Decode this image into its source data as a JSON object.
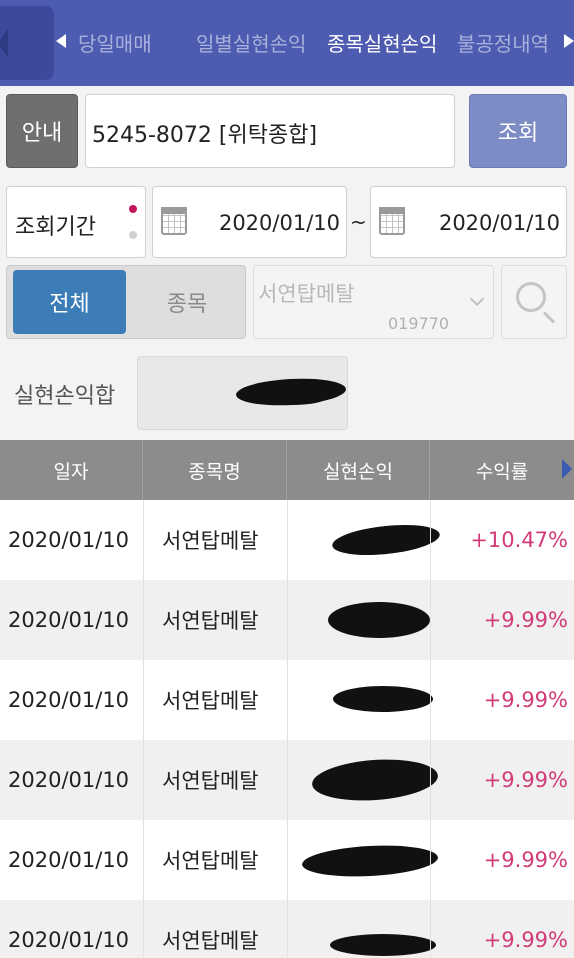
{
  "tabs": {
    "items": [
      "당일매매",
      "일별실현손익",
      "종목실현손익",
      "불공정내역"
    ],
    "active_index": 2
  },
  "account": {
    "guide_label": "안내",
    "selected": "5245-8072 [위탁종합]",
    "query_label": "조회"
  },
  "period": {
    "label": "조회기간",
    "start": "2020/01/10",
    "separator": "~",
    "end": "2020/01/10",
    "dot_colors": [
      "#c2185b",
      "#d0d0d0"
    ]
  },
  "filter": {
    "all_label": "전체",
    "item_label": "종목",
    "stock_name": "서연탑메탈",
    "stock_code": "019770"
  },
  "summary": {
    "label": "실현손익합"
  },
  "table": {
    "headers": [
      "일자",
      "종목명",
      "실현손익",
      "수익률"
    ],
    "rows": [
      {
        "date": "2020/01/10",
        "name": "서연탑메탈",
        "rate": "+10.47%"
      },
      {
        "date": "2020/01/10",
        "name": "서연탑메탈",
        "rate": "+9.99%"
      },
      {
        "date": "2020/01/10",
        "name": "서연탑메탈",
        "rate": "+9.99%"
      },
      {
        "date": "2020/01/10",
        "name": "서연탑메탈",
        "rate": "+9.99%"
      },
      {
        "date": "2020/01/10",
        "name": "서연탑메탈",
        "rate": "+9.99%"
      },
      {
        "date": "2020/01/10",
        "name": "서연탑메탈",
        "rate": "+9.99%"
      }
    ]
  },
  "colors": {
    "header_bg": "#4d5bb0",
    "accent_blue": "#3c7db8",
    "positive_rate": "#d23a78"
  }
}
